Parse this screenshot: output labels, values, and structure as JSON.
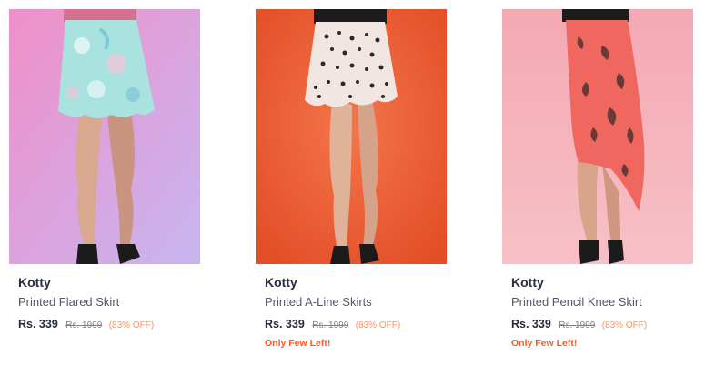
{
  "products": [
    {
      "brand": "Kotty",
      "name": "Printed Flared Skirt",
      "price": "Rs. 339",
      "mrp": "Rs. 1999",
      "discount": "(83% OFF)",
      "stock_note": "",
      "image_icon": "skirt-photo-icon",
      "bg_color": "#e9b0e6",
      "skirt_color": "#a8e3e0"
    },
    {
      "brand": "Kotty",
      "name": "Printed A-Line Skirts",
      "price": "Rs. 339",
      "mrp": "Rs. 1999",
      "discount": "(83% OFF)",
      "stock_note": "Only Few Left!",
      "image_icon": "skirt-photo-icon",
      "bg_color": "#f0643b",
      "skirt_color": "#f1e6e1"
    },
    {
      "brand": "Kotty",
      "name": "Printed Pencil Knee Skirt",
      "price": "Rs. 339",
      "mrp": "Rs. 1999",
      "discount": "(83% OFF)",
      "stock_note": "Only Few Left!",
      "image_icon": "skirt-photo-icon",
      "bg_color": "#f6b6bd",
      "skirt_color": "#f0675f"
    }
  ]
}
